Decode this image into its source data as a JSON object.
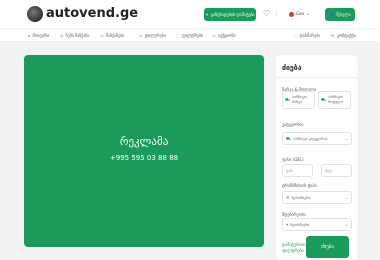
{
  "header": {
    "logo_text": "autovend.ge",
    "add_listing_label": "განცხადების დამატება",
    "language": "Geo",
    "login_label": "შესვლა",
    "separator": "|"
  },
  "nav": {
    "items": [
      {
        "label": "მთავარი",
        "icon": "home-icon",
        "glyph": "⌂"
      },
      {
        "label": "ჩემი მანქანა",
        "icon": "car-icon",
        "glyph": "◎"
      },
      {
        "label": "მანქანები",
        "icon": "car-icon",
        "glyph": "▭"
      },
      {
        "label": "დილერები",
        "icon": "store-icon",
        "glyph": "▭"
      },
      {
        "label": "ფილტრები",
        "icon": "filter-icon",
        "glyph": "◌"
      },
      {
        "label": "აუქციონი",
        "icon": "gavel-icon",
        "glyph": "▭"
      },
      {
        "label": "დახმარება",
        "icon": "help-icon",
        "glyph": "◌"
      },
      {
        "label": "კონტაქტი",
        "icon": "phone-icon",
        "glyph": "☏"
      }
    ]
  },
  "ad": {
    "title": "რეკლამა",
    "phone": "+995 595 03 88 88"
  },
  "search_panel": {
    "title": "ძიება",
    "brand_model_label": "მარკა & მოდელი",
    "options": [
      {
        "label": "აირჩიეთ მარკა",
        "icon": "car-icon"
      },
      {
        "label": "აირჩიეთ მოდელი",
        "icon": "car-icon"
      }
    ],
    "category_label": "კატეგორია",
    "category_value": "აირჩიეთ კატეგორია",
    "price_label": "ფასი (GEL)",
    "price_from": "დან",
    "price_to": "მდე",
    "price_dash": "-",
    "fuel_label": "ტრანსმისიის ტიპი",
    "fuel_value": "ნებისმიერი",
    "location_label": "მდებარეობა",
    "location_value": "ნებისმიერი",
    "more_link": "დამატებითი ფილტრები",
    "search_button": "ძიება"
  },
  "colors": {
    "accent": "#1a9b5a",
    "background": "#f2f4f3"
  }
}
